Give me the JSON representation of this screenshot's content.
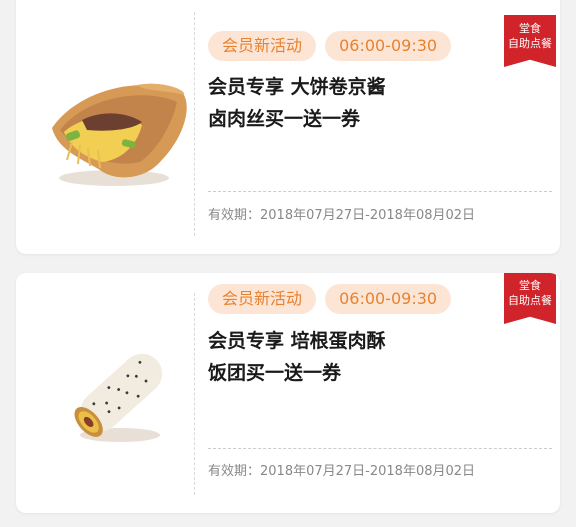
{
  "coupons": [
    {
      "tag": "会员新活动",
      "time": "06:00-09:30",
      "ribbon_line1": "堂食",
      "ribbon_line2": "自助点餐",
      "title_line1": "会员专享 大饼卷京酱",
      "title_line2": "卤肉丝买一送一券",
      "validity": "有效期：2018年07月27日-2018年08月02日"
    },
    {
      "tag": "会员新活动",
      "time": "06:00-09:30",
      "ribbon_line1": "堂食",
      "ribbon_line2": "自助点餐",
      "title_line1": "会员专享 培根蛋肉酥",
      "title_line2": "饭团买一送一券",
      "validity": "有效期：2018年07月27日-2018年08月02日"
    }
  ],
  "colors": {
    "pill_bg": "#fde5d6",
    "pill_text": "#e8822f",
    "ribbon": "#d0232a"
  }
}
